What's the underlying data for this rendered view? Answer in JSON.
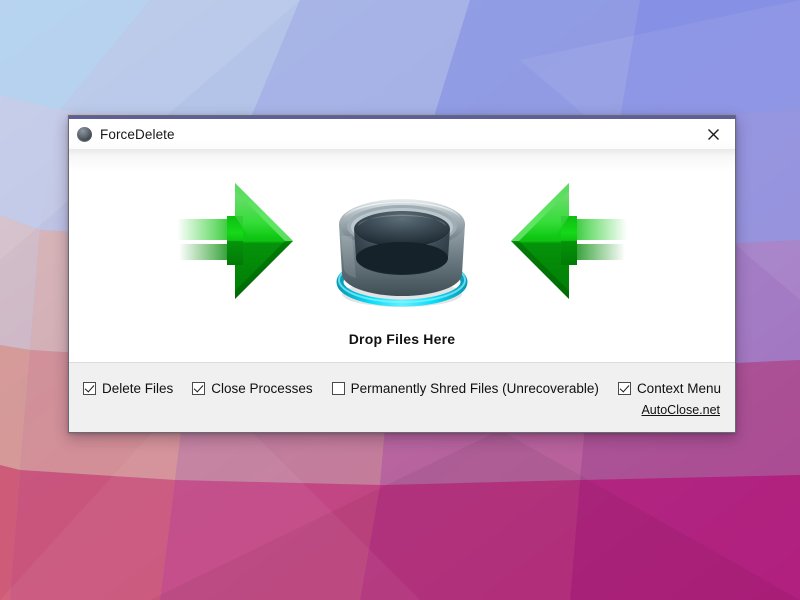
{
  "desktop": {
    "wallpaper_name": "low-poly-gradient-wallpaper",
    "palette": {
      "top_left": "#bcd4ef",
      "top_right": "#7b87e2",
      "mid_left": "#e8b3ad",
      "mid_right": "#9f7fd0",
      "bottom_left": "#d4737f",
      "bottom_right": "#b8277c",
      "center": "#b09ad0"
    }
  },
  "window": {
    "title": "ForceDelete",
    "icon": "sphere-icon",
    "accent_color": "#5f5f97",
    "close_label": "✕",
    "close_icon": "close-icon"
  },
  "drop_zone": {
    "label": "Drop Files Here",
    "left_arrow_icon": "green-arrow-right-icon",
    "right_arrow_icon": "green-arrow-left-icon",
    "bin_icon": "recycle-bin-icon",
    "arrow_color": "#00a800",
    "bin_glow_color": "#00d4f0"
  },
  "footer": {
    "options": [
      {
        "label": "Delete Files",
        "checked": true,
        "name": "delete-files"
      },
      {
        "label": "Close Processes",
        "checked": true,
        "name": "close-processes"
      },
      {
        "label": "Permanently Shred Files (Unrecoverable)",
        "checked": false,
        "name": "permanently-shred-files"
      },
      {
        "label": "Context Menu",
        "checked": true,
        "name": "context-menu"
      }
    ],
    "link": "AutoClose.net"
  }
}
